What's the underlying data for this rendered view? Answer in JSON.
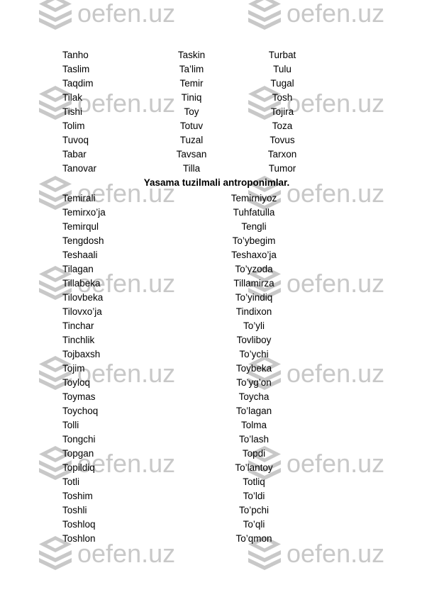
{
  "page": {
    "watermark": {
      "text": "oefen.uz",
      "logo_icon": "layers-stack-icon",
      "color": "#c8c8c8"
    }
  },
  "document": {
    "simple_names_table": {
      "columns": 3,
      "rows": [
        [
          "Tanho",
          "Taskin",
          "Turbat"
        ],
        [
          "Taslim",
          "Ta’lim",
          "Tulu"
        ],
        [
          "Taqdim",
          "Temir",
          "Tugal"
        ],
        [
          "Tilak",
          "Tiniq",
          "Tosh"
        ],
        [
          "Tishi",
          "Toy",
          "Tojira"
        ],
        [
          "Tolim",
          "Totuv",
          "Toza"
        ],
        [
          "Tuvoq",
          "Tuzal",
          "Tovus"
        ],
        [
          "Tabar",
          "Tavsan",
          "Tarxon"
        ],
        [
          "Tanovar",
          "Tilla",
          "Tumor"
        ]
      ]
    },
    "heading": "Yasama tuzilmali antroponimlar.",
    "derived_names_table": {
      "columns": 2,
      "rows": [
        [
          "Temirali",
          "Temirniyoz"
        ],
        [
          "Temirxo’ja",
          "Tuhfatulla"
        ],
        [
          "Temirqul",
          "Tengli"
        ],
        [
          "Tengdosh",
          "To’ybegim"
        ],
        [
          "Teshaali",
          "Teshaxo’ja"
        ],
        [
          "Tilagan",
          "To’yzoda"
        ],
        [
          "Tillabeka",
          "Tillamirza"
        ],
        [
          "Tilovbeka",
          "To’yindiq"
        ],
        [
          "Tilovxo’ja",
          "Tindixon"
        ],
        [
          "Tinchar",
          "To’yli"
        ],
        [
          "Tinchlik",
          "Tovliboy"
        ],
        [
          "Tojbaxsh",
          "To’ychi"
        ],
        [
          "Tojim",
          "Toybeka"
        ],
        [
          "Toyloq",
          "To’yg’on"
        ],
        [
          "Toymas",
          "Toycha"
        ],
        [
          "Toychoq",
          "To’lagan"
        ],
        [
          "Tolli",
          "Tolma"
        ],
        [
          "Tongchi",
          "To’lash"
        ],
        [
          "Topgan",
          "Topdi"
        ],
        [
          "Topildiq",
          "To’lantoy"
        ],
        [
          "Totli",
          "Totliq"
        ],
        [
          "Toshim",
          "To’ldi"
        ],
        [
          "Toshli",
          "To’pchi"
        ],
        [
          "Toshloq",
          "To’qli"
        ],
        [
          "Toshlon",
          "To’qmon"
        ]
      ]
    }
  }
}
